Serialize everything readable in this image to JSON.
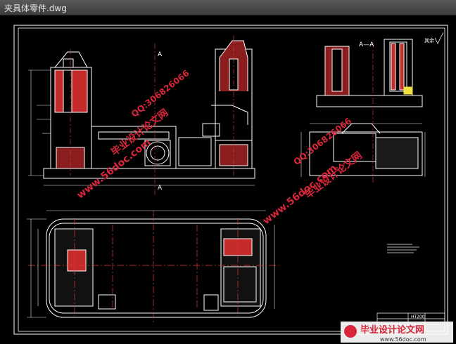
{
  "window": {
    "title": "夹具体零件.dwg"
  },
  "drawing": {
    "section_mark_a": "A",
    "section_mark_a_bottom": "A",
    "section_view_title": "A—A",
    "material_label": "HT200",
    "roughness_note": "其余"
  },
  "watermarks": {
    "site_name": "毕业设计论文网",
    "url": "www.56doc.com",
    "qq": "QQ:306826066"
  },
  "colors": {
    "background": "#000000",
    "outline": "#ffffff",
    "hatch": "#e23b3b",
    "centerline": "#e23b3b",
    "dimension": "#e8e8e8",
    "accent_yellow": "#f0e040",
    "watermark": "#d9263a"
  }
}
